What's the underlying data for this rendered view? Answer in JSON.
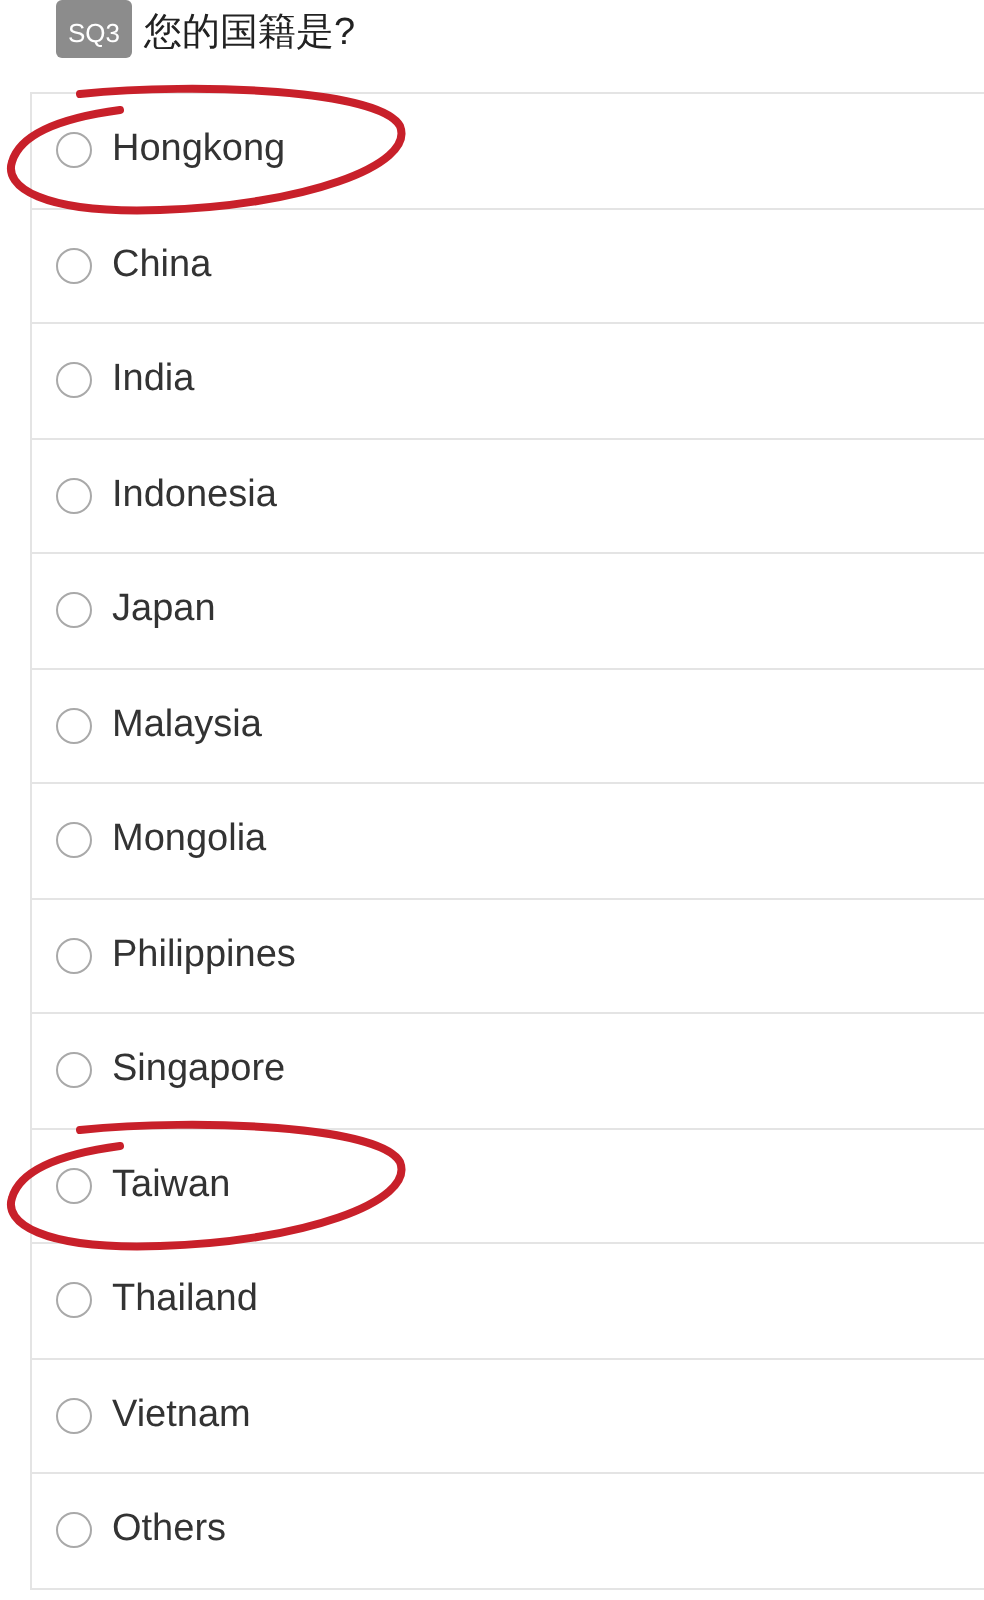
{
  "question": {
    "code": "SQ3",
    "text": "您的国籍是?"
  },
  "options": [
    {
      "label": "Hongkong",
      "selected": false,
      "circled": true
    },
    {
      "label": "China",
      "selected": false,
      "circled": false
    },
    {
      "label": "India",
      "selected": false,
      "circled": false
    },
    {
      "label": "Indonesia",
      "selected": false,
      "circled": false
    },
    {
      "label": "Japan",
      "selected": false,
      "circled": false
    },
    {
      "label": "Malaysia",
      "selected": false,
      "circled": false
    },
    {
      "label": "Mongolia",
      "selected": false,
      "circled": false
    },
    {
      "label": "Philippines",
      "selected": false,
      "circled": false
    },
    {
      "label": "Singapore",
      "selected": false,
      "circled": false
    },
    {
      "label": "Taiwan",
      "selected": false,
      "circled": true
    },
    {
      "label": "Thailand",
      "selected": false,
      "circled": false
    },
    {
      "label": "Vietnam",
      "selected": false,
      "circled": false
    },
    {
      "label": "Others",
      "selected": false,
      "circled": false
    }
  ]
}
